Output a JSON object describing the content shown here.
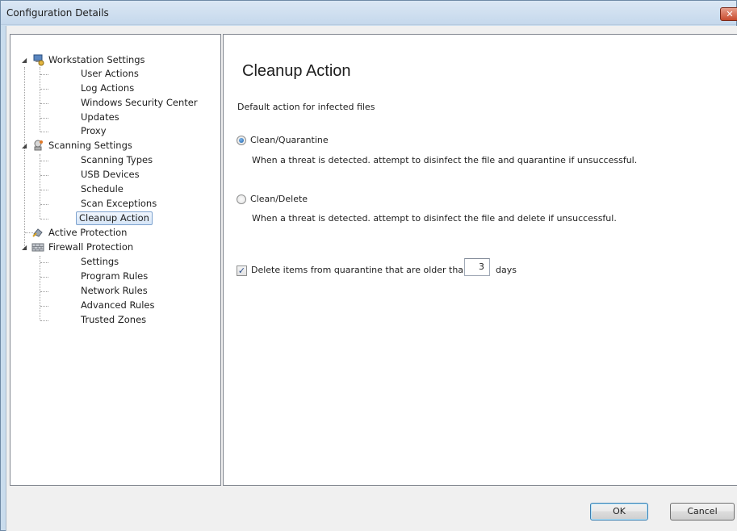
{
  "window": {
    "title": "Configuration Details",
    "close_glyph": "✕"
  },
  "tree": {
    "groups": [
      {
        "label": "Workstation Settings",
        "icon": "workstation-icon",
        "children": [
          "User Actions",
          "Log Actions",
          "Windows Security Center",
          "Updates",
          "Proxy"
        ]
      },
      {
        "label": "Scanning Settings",
        "icon": "scanning-icon",
        "children": [
          "Scanning Types",
          "USB Devices",
          "Schedule",
          "Scan Exceptions",
          "Cleanup Action"
        ]
      },
      {
        "label": "Active Protection",
        "icon": "active-protection-icon",
        "children": []
      },
      {
        "label": "Firewall Protection",
        "icon": "firewall-icon",
        "children": [
          "Settings",
          "Program Rules",
          "Network Rules",
          "Advanced Rules",
          "Trusted Zones"
        ]
      }
    ],
    "selected": "Cleanup Action"
  },
  "content": {
    "title": "Cleanup Action",
    "subtitle": "Default action for infected files",
    "options": [
      {
        "label": "Clean/Quarantine",
        "checked": true,
        "description": "When a threat is detected. attempt to disinfect the file and quarantine if unsuccessful."
      },
      {
        "label": "Clean/Delete",
        "checked": false,
        "description": "When a threat is detected. attempt to disinfect the file and delete if unsuccessful."
      }
    ],
    "delete_quarantine": {
      "label": "Delete items from quarantine that are older than",
      "checked": true,
      "value": "3",
      "unit": "days"
    }
  },
  "buttons": {
    "ok": "OK",
    "cancel": "Cancel"
  }
}
